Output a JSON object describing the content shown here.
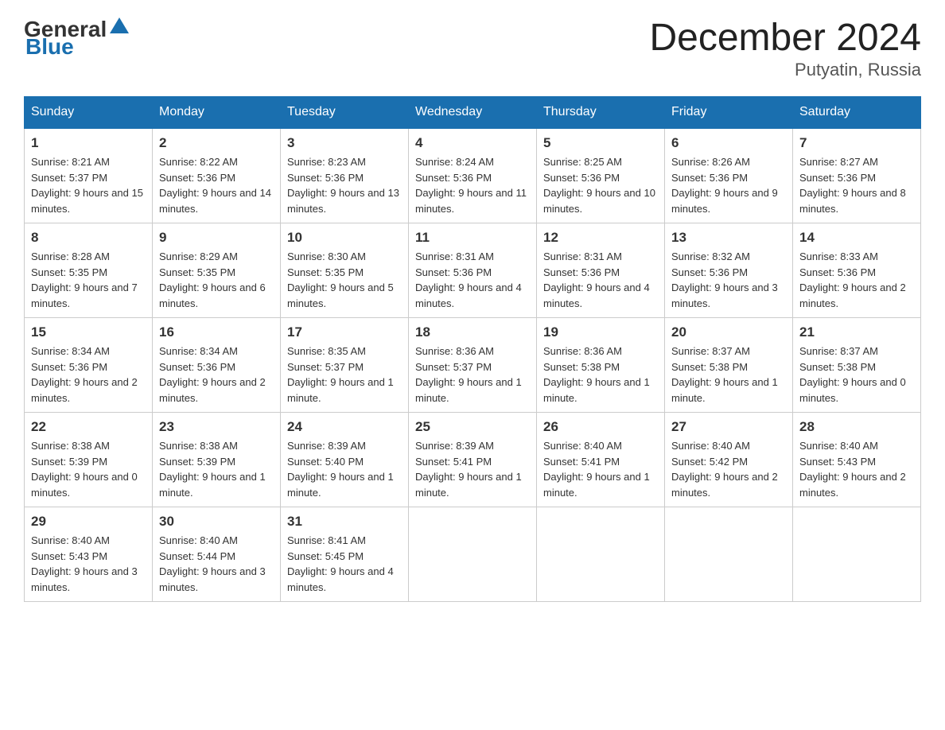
{
  "header": {
    "logo_general": "General",
    "logo_blue": "Blue",
    "month_year": "December 2024",
    "location": "Putyatin, Russia"
  },
  "weekdays": [
    "Sunday",
    "Monday",
    "Tuesday",
    "Wednesday",
    "Thursday",
    "Friday",
    "Saturday"
  ],
  "weeks": [
    [
      {
        "day": "1",
        "sunrise": "8:21 AM",
        "sunset": "5:37 PM",
        "daylight": "9 hours and 15 minutes."
      },
      {
        "day": "2",
        "sunrise": "8:22 AM",
        "sunset": "5:36 PM",
        "daylight": "9 hours and 14 minutes."
      },
      {
        "day": "3",
        "sunrise": "8:23 AM",
        "sunset": "5:36 PM",
        "daylight": "9 hours and 13 minutes."
      },
      {
        "day": "4",
        "sunrise": "8:24 AM",
        "sunset": "5:36 PM",
        "daylight": "9 hours and 11 minutes."
      },
      {
        "day": "5",
        "sunrise": "8:25 AM",
        "sunset": "5:36 PM",
        "daylight": "9 hours and 10 minutes."
      },
      {
        "day": "6",
        "sunrise": "8:26 AM",
        "sunset": "5:36 PM",
        "daylight": "9 hours and 9 minutes."
      },
      {
        "day": "7",
        "sunrise": "8:27 AM",
        "sunset": "5:36 PM",
        "daylight": "9 hours and 8 minutes."
      }
    ],
    [
      {
        "day": "8",
        "sunrise": "8:28 AM",
        "sunset": "5:35 PM",
        "daylight": "9 hours and 7 minutes."
      },
      {
        "day": "9",
        "sunrise": "8:29 AM",
        "sunset": "5:35 PM",
        "daylight": "9 hours and 6 minutes."
      },
      {
        "day": "10",
        "sunrise": "8:30 AM",
        "sunset": "5:35 PM",
        "daylight": "9 hours and 5 minutes."
      },
      {
        "day": "11",
        "sunrise": "8:31 AM",
        "sunset": "5:36 PM",
        "daylight": "9 hours and 4 minutes."
      },
      {
        "day": "12",
        "sunrise": "8:31 AM",
        "sunset": "5:36 PM",
        "daylight": "9 hours and 4 minutes."
      },
      {
        "day": "13",
        "sunrise": "8:32 AM",
        "sunset": "5:36 PM",
        "daylight": "9 hours and 3 minutes."
      },
      {
        "day": "14",
        "sunrise": "8:33 AM",
        "sunset": "5:36 PM",
        "daylight": "9 hours and 2 minutes."
      }
    ],
    [
      {
        "day": "15",
        "sunrise": "8:34 AM",
        "sunset": "5:36 PM",
        "daylight": "9 hours and 2 minutes."
      },
      {
        "day": "16",
        "sunrise": "8:34 AM",
        "sunset": "5:36 PM",
        "daylight": "9 hours and 2 minutes."
      },
      {
        "day": "17",
        "sunrise": "8:35 AM",
        "sunset": "5:37 PM",
        "daylight": "9 hours and 1 minute."
      },
      {
        "day": "18",
        "sunrise": "8:36 AM",
        "sunset": "5:37 PM",
        "daylight": "9 hours and 1 minute."
      },
      {
        "day": "19",
        "sunrise": "8:36 AM",
        "sunset": "5:38 PM",
        "daylight": "9 hours and 1 minute."
      },
      {
        "day": "20",
        "sunrise": "8:37 AM",
        "sunset": "5:38 PM",
        "daylight": "9 hours and 1 minute."
      },
      {
        "day": "21",
        "sunrise": "8:37 AM",
        "sunset": "5:38 PM",
        "daylight": "9 hours and 0 minutes."
      }
    ],
    [
      {
        "day": "22",
        "sunrise": "8:38 AM",
        "sunset": "5:39 PM",
        "daylight": "9 hours and 0 minutes."
      },
      {
        "day": "23",
        "sunrise": "8:38 AM",
        "sunset": "5:39 PM",
        "daylight": "9 hours and 1 minute."
      },
      {
        "day": "24",
        "sunrise": "8:39 AM",
        "sunset": "5:40 PM",
        "daylight": "9 hours and 1 minute."
      },
      {
        "day": "25",
        "sunrise": "8:39 AM",
        "sunset": "5:41 PM",
        "daylight": "9 hours and 1 minute."
      },
      {
        "day": "26",
        "sunrise": "8:40 AM",
        "sunset": "5:41 PM",
        "daylight": "9 hours and 1 minute."
      },
      {
        "day": "27",
        "sunrise": "8:40 AM",
        "sunset": "5:42 PM",
        "daylight": "9 hours and 2 minutes."
      },
      {
        "day": "28",
        "sunrise": "8:40 AM",
        "sunset": "5:43 PM",
        "daylight": "9 hours and 2 minutes."
      }
    ],
    [
      {
        "day": "29",
        "sunrise": "8:40 AM",
        "sunset": "5:43 PM",
        "daylight": "9 hours and 3 minutes."
      },
      {
        "day": "30",
        "sunrise": "8:40 AM",
        "sunset": "5:44 PM",
        "daylight": "9 hours and 3 minutes."
      },
      {
        "day": "31",
        "sunrise": "8:41 AM",
        "sunset": "5:45 PM",
        "daylight": "9 hours and 4 minutes."
      },
      null,
      null,
      null,
      null
    ]
  ]
}
